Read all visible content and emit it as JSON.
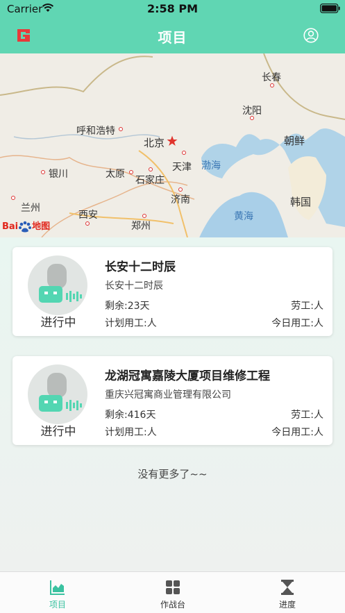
{
  "status_bar": {
    "carrier": "Carrier",
    "time": "2:58 PM"
  },
  "nav": {
    "title": "项目"
  },
  "colors": {
    "accent": "#60d6b3",
    "tab_active": "#3ac2a0",
    "icon_bg": "#e1e5e3",
    "icon_teal": "#53d6b2",
    "icon_gray": "#b8bcba",
    "logo_red": "#e83a3a"
  },
  "map": {
    "cities": {
      "changchun": "长春",
      "shenyang": "沈阳",
      "hohhot": "呼和浩特",
      "beijing": "北京",
      "tianjin": "天津",
      "yinchuan": "银川",
      "taiyuan": "太原",
      "shijiazhuang": "石家庄",
      "lanzhou": "兰州",
      "jinan": "济南",
      "xian": "西安",
      "zhengzhou": "郑州"
    },
    "countries": {
      "north_korea": "朝鲜",
      "south_korea": "韩国"
    },
    "seas": {
      "bohai": "渤海",
      "yellow_sea": "黄海"
    },
    "logo": {
      "text_bai": "Bai",
      "text_map": "地图"
    }
  },
  "projects": [
    {
      "name": "长安十二时辰",
      "company": "长安十二时辰",
      "remaining": "剩余:23天",
      "workers": "劳工:人",
      "planned": "计划用工:人",
      "today": "今日用工:人",
      "status": "进行中"
    },
    {
      "name": "龙湖冠寓嘉陵大厦项目维修工程",
      "company": "重庆兴冠寓商业管理有限公司",
      "remaining": "剩余:416天",
      "workers": "劳工:人",
      "planned": "计划用工:人",
      "today": "今日用工:人",
      "status": "进行中"
    }
  ],
  "list_end_text": "没有更多了~~",
  "tabs": [
    {
      "label": "项目",
      "icon": "chart-icon",
      "active": true
    },
    {
      "label": "作战台",
      "icon": "grid-icon",
      "active": false
    },
    {
      "label": "进度",
      "icon": "hourglass-icon",
      "active": false
    }
  ]
}
